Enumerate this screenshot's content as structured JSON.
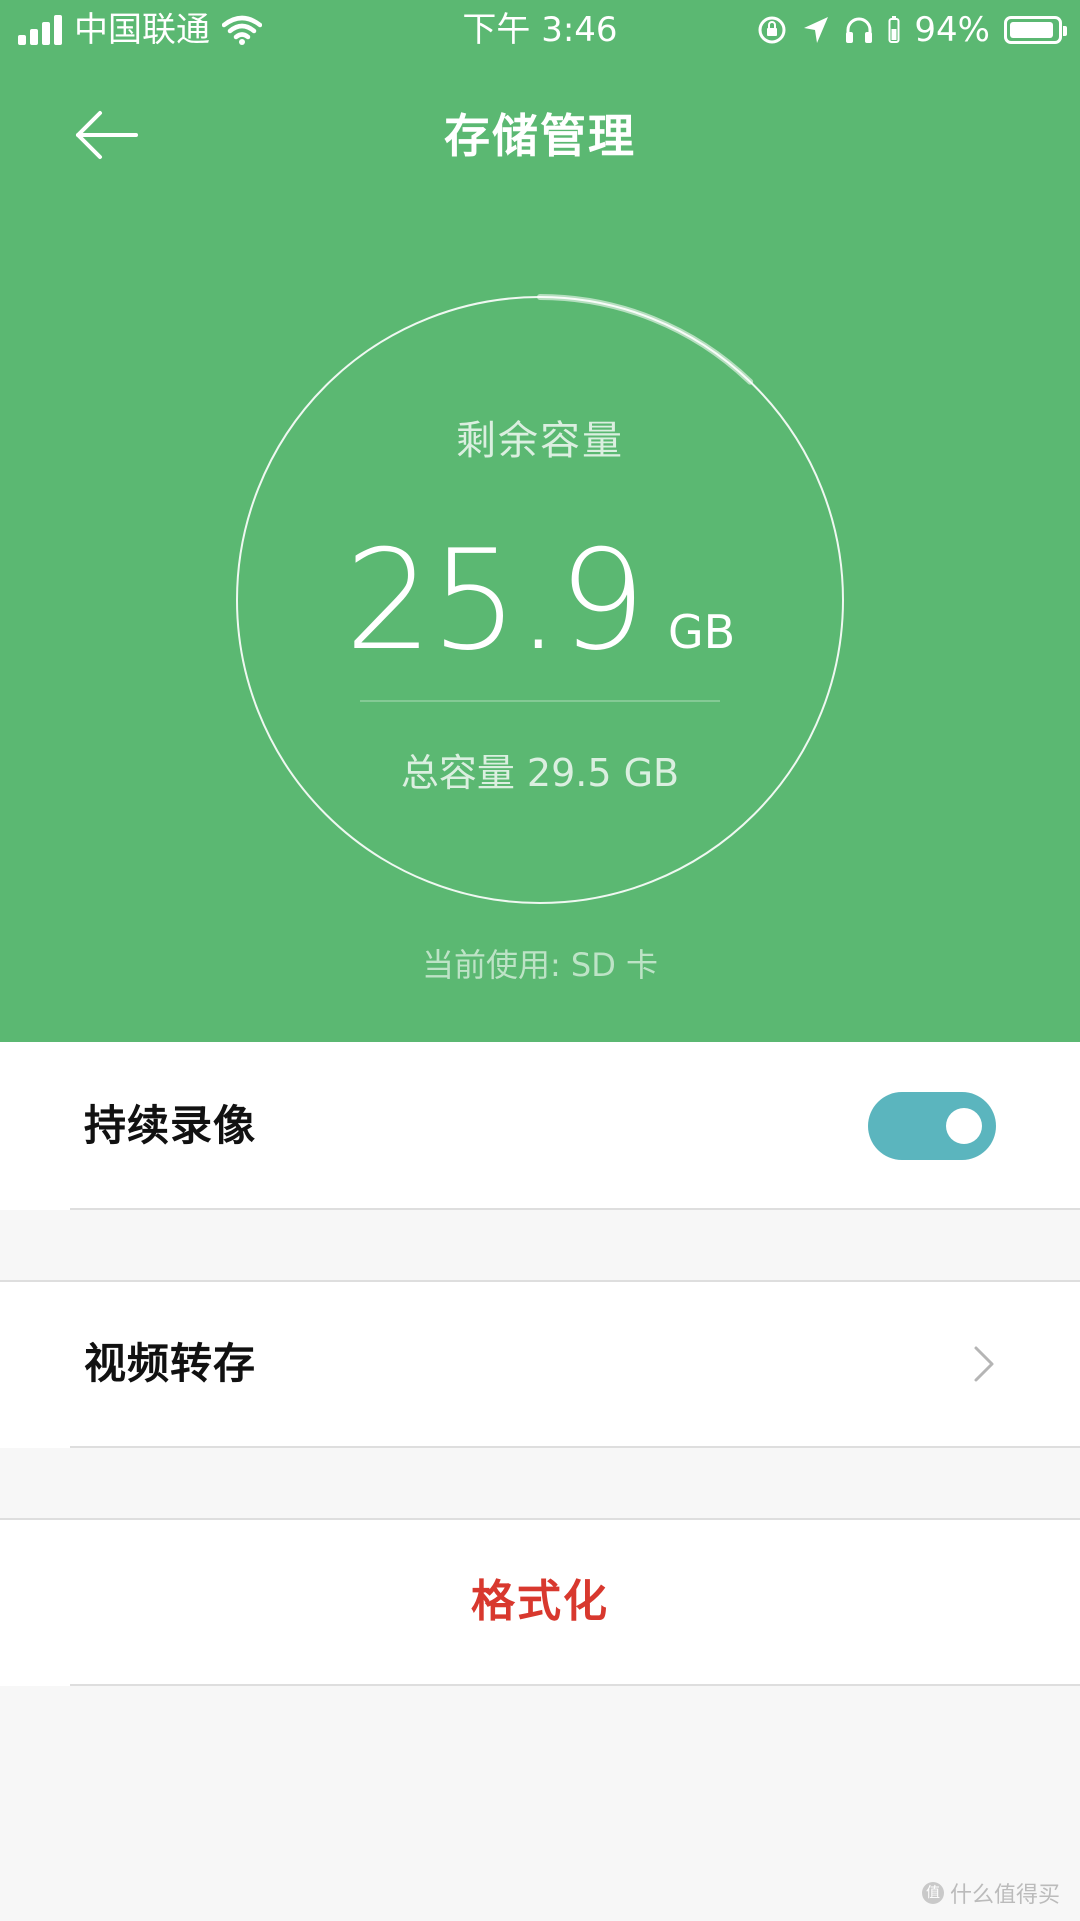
{
  "status_bar": {
    "carrier": "中国联通",
    "time": "下午 3:46",
    "battery_text": "94%",
    "battery_level": 0.94
  },
  "header": {
    "title": "存储管理"
  },
  "storage": {
    "remaining_label": "剩余容量",
    "remaining_value": "25.9",
    "remaining_unit": "GB",
    "total_text": "总容量 29.5 GB",
    "current_text": "当前使用: SD 卡",
    "used_fraction": 0.122
  },
  "settings": {
    "continuous_recording": {
      "label": "持续录像",
      "enabled": true
    },
    "video_transfer": {
      "label": "视频转存"
    },
    "format": {
      "label": "格式化"
    }
  },
  "watermark": {
    "text": "什么值得买",
    "icon_glyph": "值"
  },
  "colors": {
    "primary_green": "#5bb872",
    "toggle_on": "#5bb5be",
    "danger": "#d8382e"
  }
}
